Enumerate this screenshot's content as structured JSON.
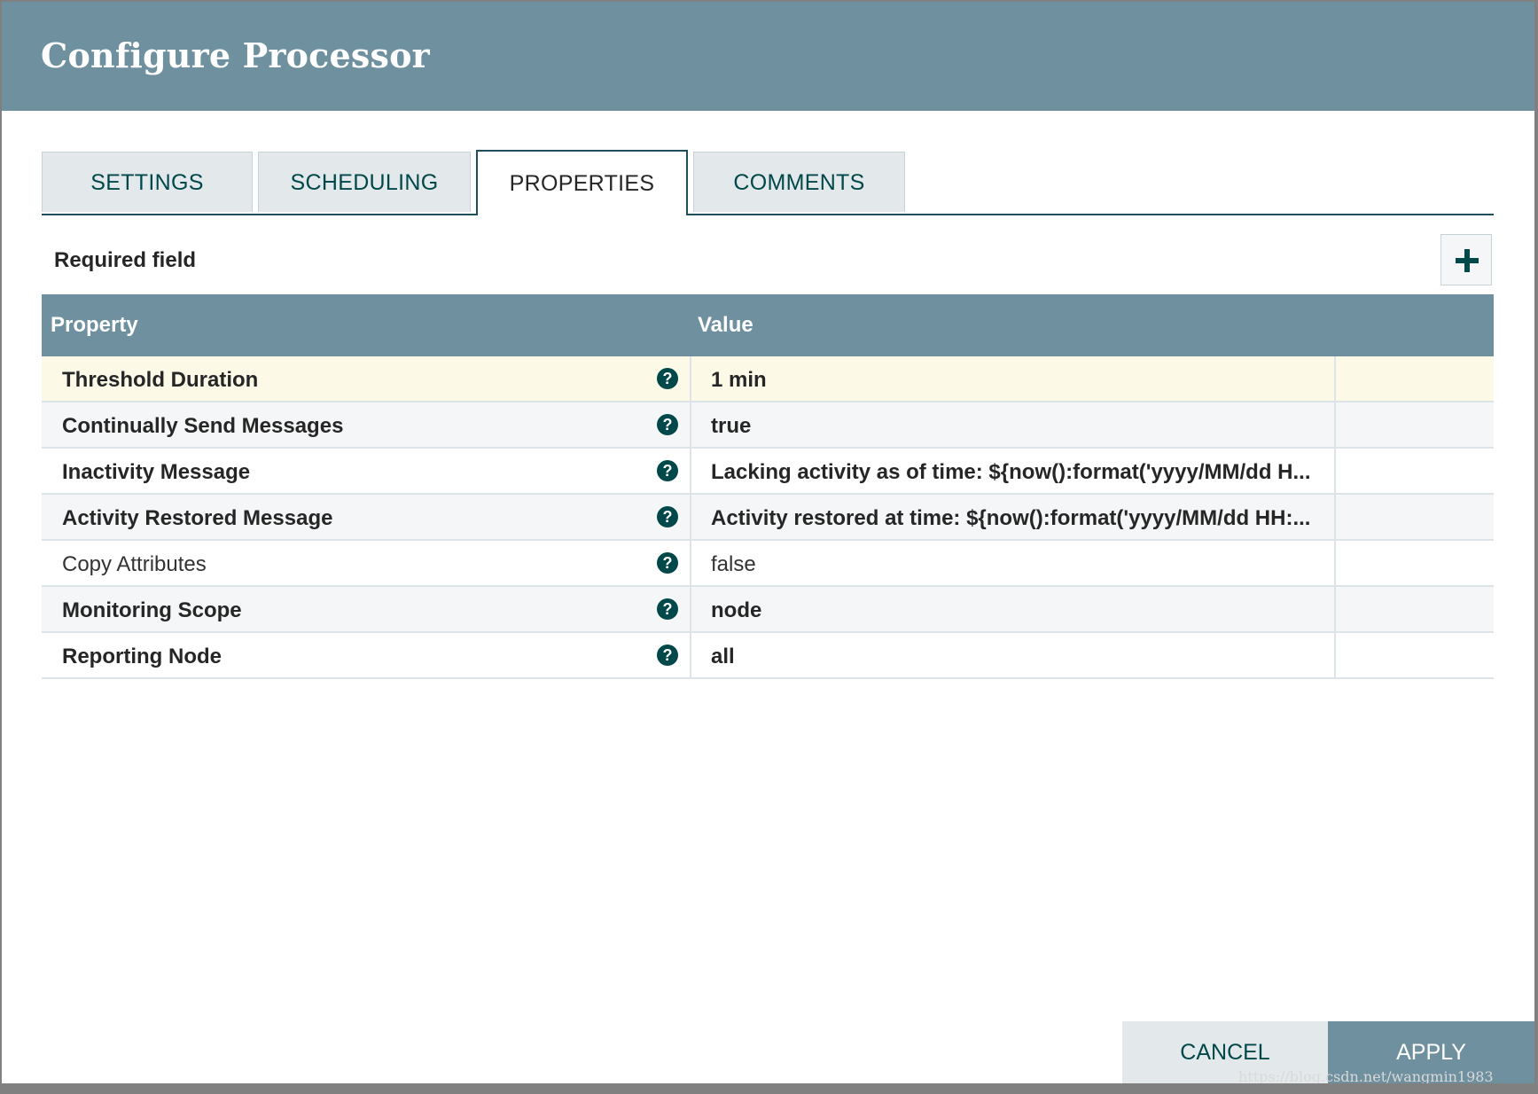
{
  "dialog": {
    "title": "Configure Processor"
  },
  "tabs": [
    {
      "label": "SETTINGS",
      "active": false
    },
    {
      "label": "SCHEDULING",
      "active": false
    },
    {
      "label": "PROPERTIES",
      "active": true
    },
    {
      "label": "COMMENTS",
      "active": false
    }
  ],
  "properties_panel": {
    "required_label": "Required field",
    "add_icon": "plus-icon",
    "columns": {
      "property": "Property",
      "value": "Value"
    },
    "rows": [
      {
        "name": "Threshold Duration",
        "value": "1 min",
        "required": true,
        "selected": true,
        "help_icon": "question-circle-icon"
      },
      {
        "name": "Continually Send Messages",
        "value": "true",
        "required": true,
        "selected": false,
        "help_icon": "question-circle-icon"
      },
      {
        "name": "Inactivity Message",
        "value": "Lacking activity as of time: ${now():format('yyyy/MM/dd H...",
        "required": true,
        "selected": false,
        "help_icon": "question-circle-icon"
      },
      {
        "name": "Activity Restored Message",
        "value": "Activity restored at time: ${now():format('yyyy/MM/dd HH:...",
        "required": true,
        "selected": false,
        "help_icon": "question-circle-icon"
      },
      {
        "name": "Copy Attributes",
        "value": "false",
        "required": false,
        "selected": false,
        "help_icon": "question-circle-icon"
      },
      {
        "name": "Monitoring Scope",
        "value": "node",
        "required": true,
        "selected": false,
        "help_icon": "question-circle-icon"
      },
      {
        "name": "Reporting Node",
        "value": "all",
        "required": true,
        "selected": false,
        "help_icon": "question-circle-icon"
      }
    ]
  },
  "footer": {
    "cancel_label": "CANCEL",
    "apply_label": "APPLY"
  },
  "watermark": "https://blog.csdn.net/wangmin1983",
  "colors": {
    "header": "#6f909f",
    "accent": "#004849",
    "selected_row": "#fcf9e6"
  }
}
